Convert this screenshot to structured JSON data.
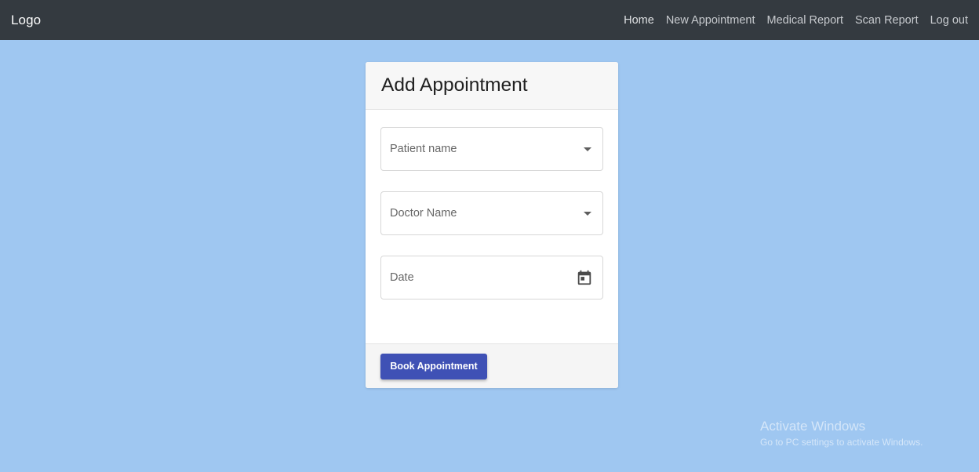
{
  "navbar": {
    "logo": "Logo",
    "links": [
      {
        "label": "Home"
      },
      {
        "label": "New Appointment"
      },
      {
        "label": "Medical Report"
      },
      {
        "label": "Scan Report"
      },
      {
        "label": "Log out"
      }
    ]
  },
  "form": {
    "title": "Add Appointment",
    "patient_field": {
      "label": "Patient name",
      "icon": "chevron-down-icon"
    },
    "doctor_field": {
      "label": "Doctor Name",
      "icon": "chevron-down-icon"
    },
    "date_field": {
      "label": "Date",
      "icon": "calendar-icon"
    },
    "submit_label": "Book Appointment"
  },
  "watermark": {
    "title": "Activate Windows",
    "subtitle": "Go to PC settings to activate Windows."
  },
  "colors": {
    "page_background": "#9fc7f1",
    "navbar_background": "#343a40",
    "primary_button": "#3f51b5"
  }
}
